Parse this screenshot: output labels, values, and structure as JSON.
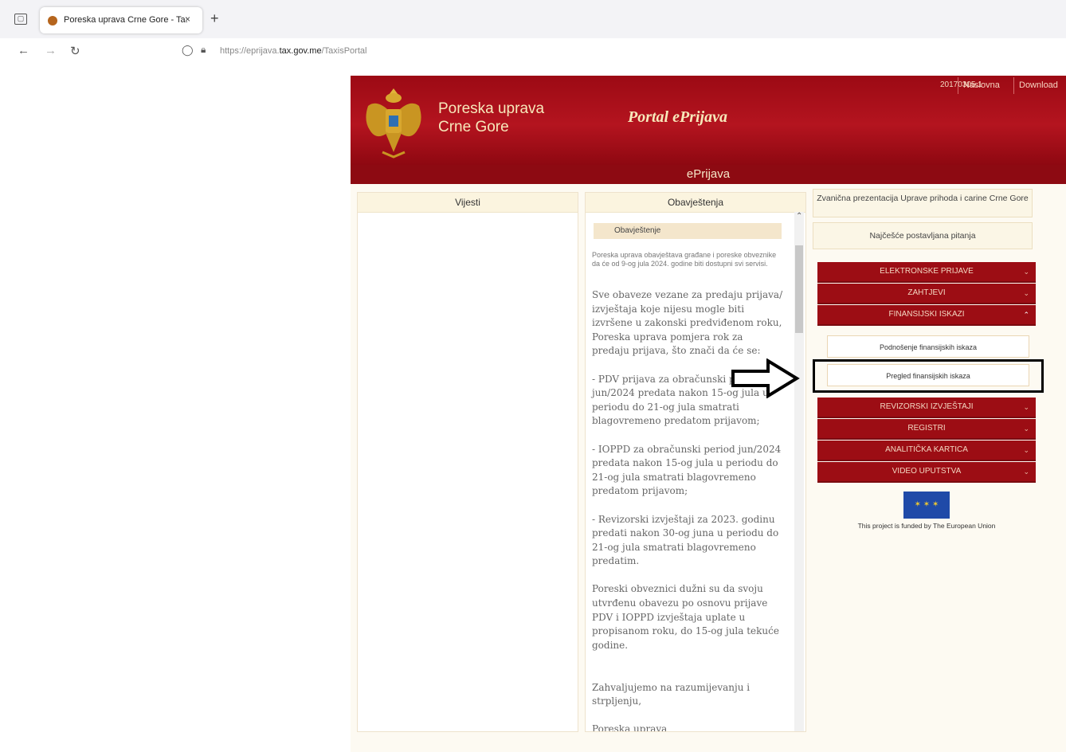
{
  "browser": {
    "tab_title": "Poreska uprava Crne Gore - Ta:",
    "tab_close": "×",
    "new_tab": "+",
    "url_prefix": "https://eprijava.",
    "url_domain": "tax.gov.me",
    "url_suffix": "/TaxisPortal"
  },
  "header": {
    "org_line1": "Poreska uprava",
    "org_line2": "Crne Gore",
    "portal_title": "Portal ePrijava",
    "version": "20170305.1",
    "links": [
      "Naslovna",
      "Download"
    ],
    "subbar": "ePrijava"
  },
  "columns": {
    "news_title": "Vijesti",
    "notices_title": "Obavještenja"
  },
  "notice": {
    "box_label": "Obavještenje",
    "small_text": "Poreska uprava obavještava građane i poreske obveznike da će od 9-og jula 2024. godine biti dostupni svi servisi.",
    "body": "Sve obaveze vezane za predaju prijava/ izvještaja koje nijesu mogle biti izvršene u zakonski predviđenom roku, Poreska uprava  pomjera rok za predaju prijava, što znači da će se:\n\n-  PDV prijava za obračunski period jun/2024 predata nakon  15-og jula u periodu do 21-og jula smatrati blagovremeno predatom prijavom;\n\n-  IOPPD za obračunski period jun/2024 predata nakon  15-og jula  u periodu do 21-og jula smatrati blagovremeno predatom prijavom;\n\n-  Revizorski izvještaji za 2023. godinu predati nakon  30-og juna  u periodu do 21-og jula smatrati blagovremeno predatim.\n\nPoreski obveznici dužni su  da svoju utvrđenu obavezu  po osnovu prijave PDV i IOPPD izvještaja uplate u propisanom roku,  do 15-og jula tekuće godine.\n\n\nZahvaljujemo na razumijevanju i strpljenju,\n\nPoreska uprava"
  },
  "sidebar": {
    "link1": "Zvanična prezentacija Uprave prihoda i carine Crne Gore",
    "link2": "Najčešće postavljana pitanja",
    "menu": [
      {
        "label": "ELEKTRONSKE PRIJAVE"
      },
      {
        "label": "ZAHTJEVI"
      },
      {
        "label": "FINANSIJSKI ISKAZI"
      },
      {
        "label": "REVIZORSKI IZVJEŠTAJI"
      },
      {
        "label": "REGISTRI"
      },
      {
        "label": "ANALITIČKA KARTICA"
      },
      {
        "label": "VIDEO UPUTSTVA"
      }
    ],
    "submenu": [
      "Podnošenje finansijskih iskaza",
      "Pregled finansijskih iskaza"
    ],
    "eu_text": "This project is funded by The European Union"
  },
  "icons": {
    "chevron_down": "⌄",
    "chevron_up": "⌃"
  }
}
